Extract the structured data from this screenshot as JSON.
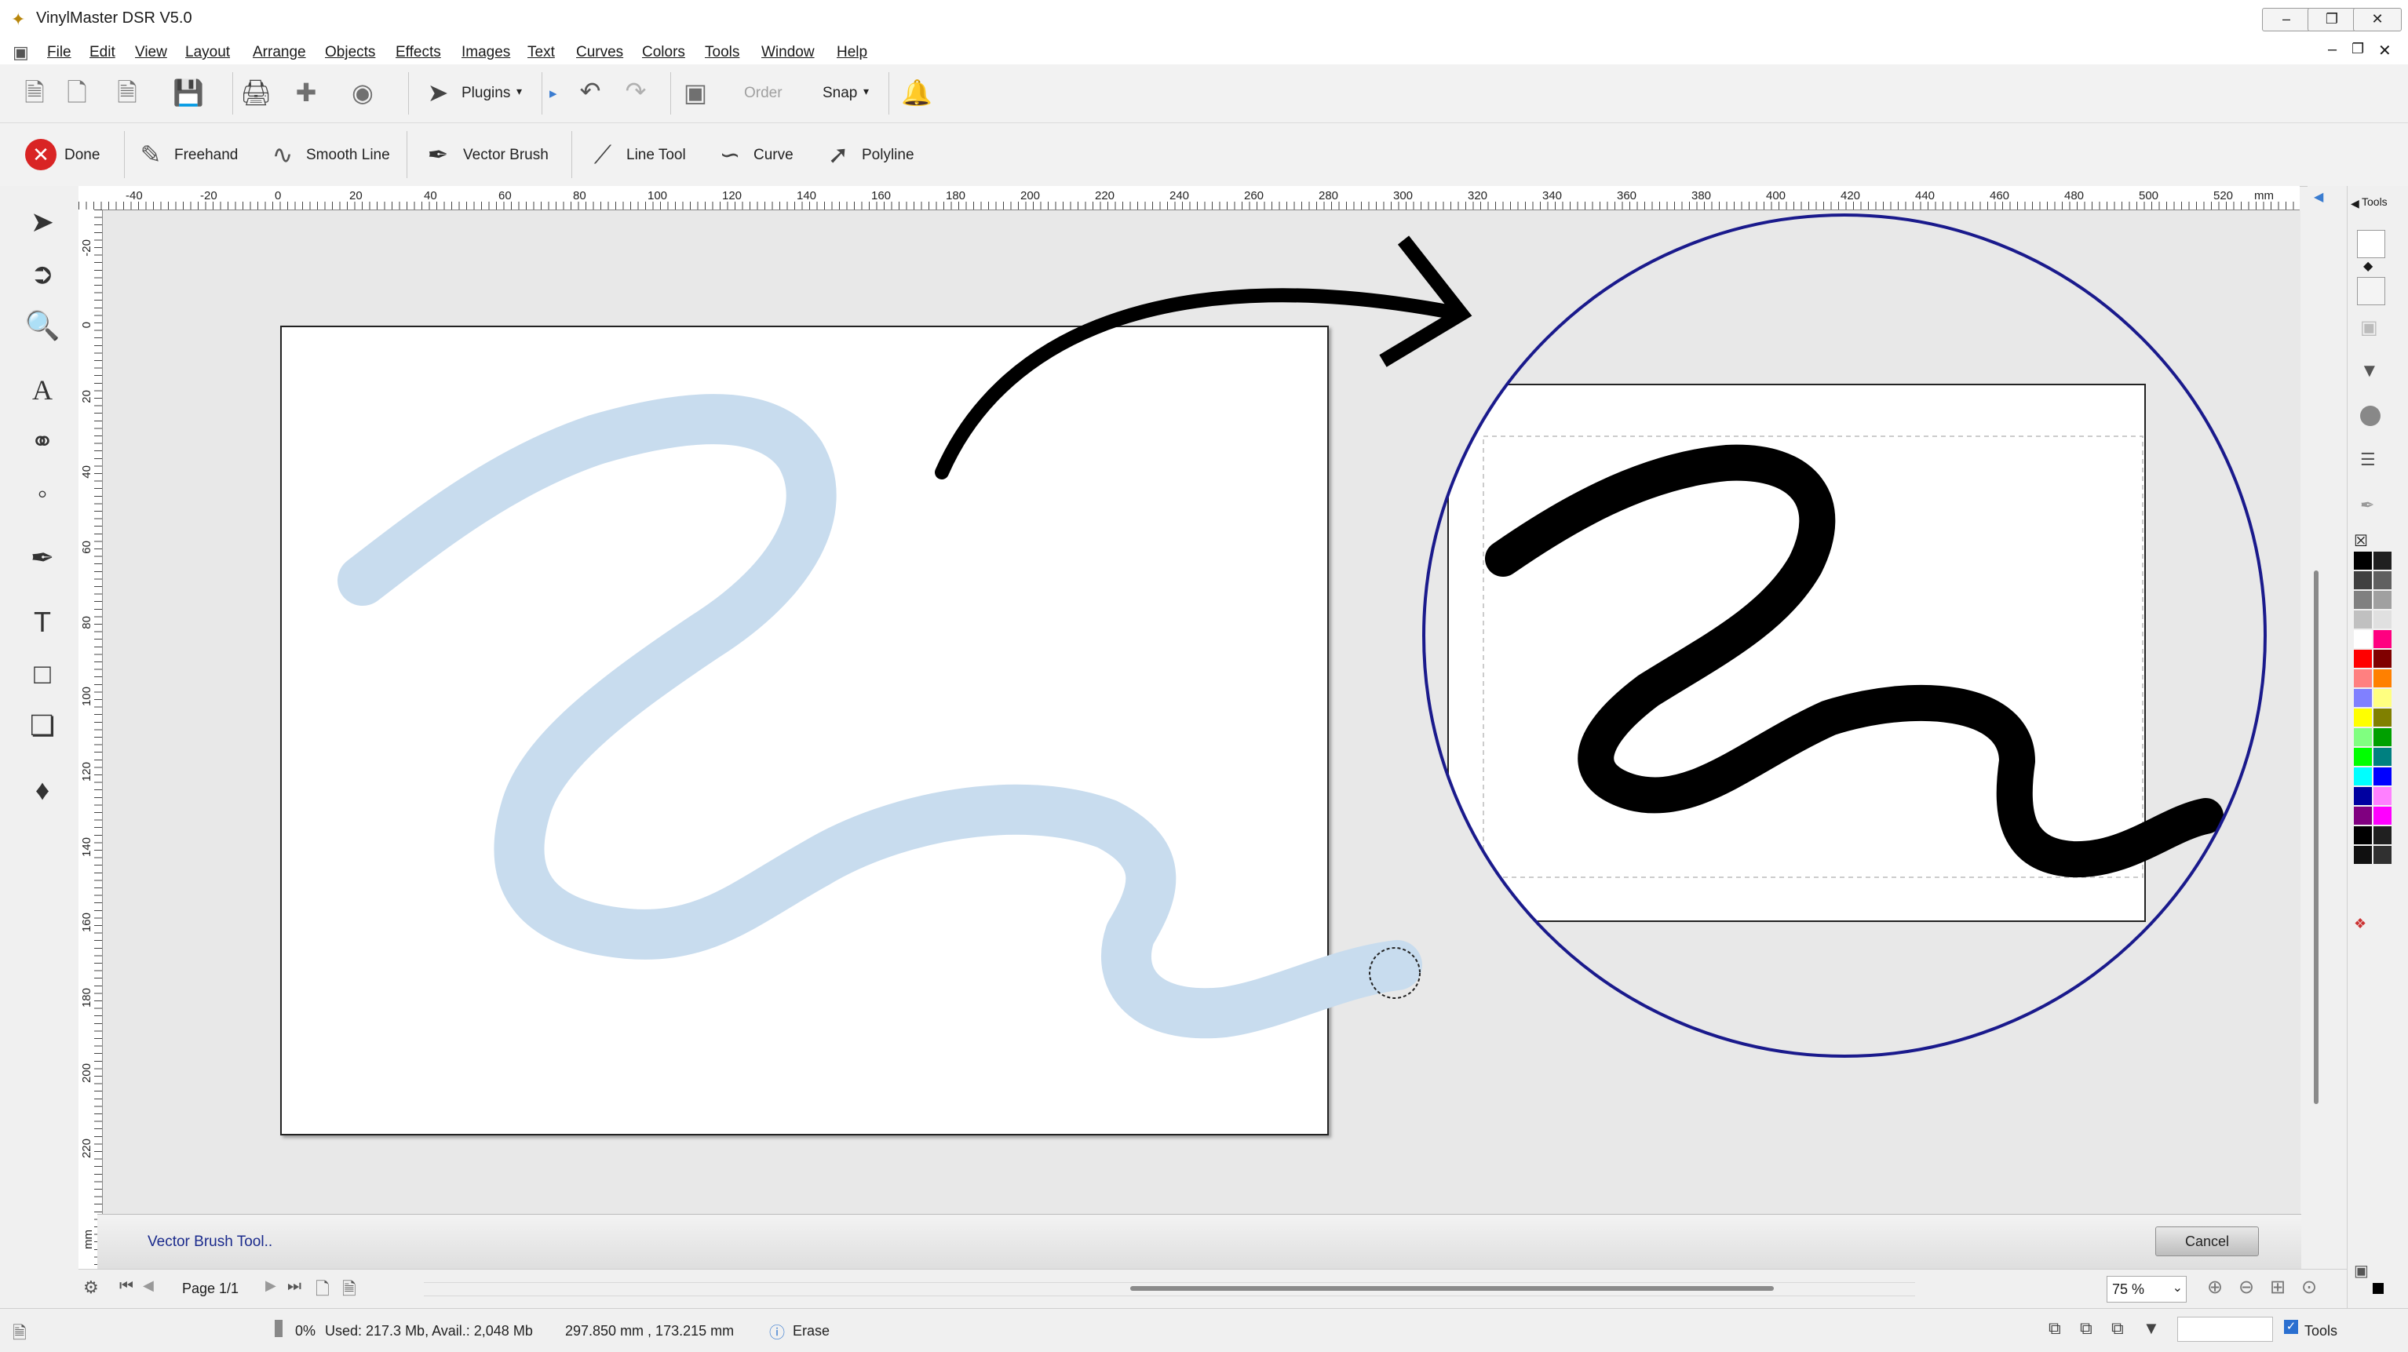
{
  "app": {
    "title": "VinylMaster DSR V5.0"
  },
  "window_controls": {
    "minimize": "–",
    "restore": "❐",
    "close": "✕"
  },
  "menu": [
    "File",
    "Edit",
    "View",
    "Layout",
    "Arrange",
    "Objects",
    "Effects",
    "Images",
    "Text",
    "Curves",
    "Colors",
    "Tools",
    "Window",
    "Help"
  ],
  "toolbar": {
    "plugins": "Plugins",
    "order": "Order",
    "snap": "Snap"
  },
  "draw_toolbar": {
    "done": "Done",
    "freehand": "Freehand",
    "smooth_line": "Smooth Line",
    "vector_brush": "Vector Brush",
    "line_tool": "Line Tool",
    "curve": "Curve",
    "polyline": "Polyline"
  },
  "ruler": {
    "unit": "mm",
    "h_labels": [
      "-40",
      "-20",
      "0",
      "20",
      "40",
      "60",
      "80",
      "100",
      "120",
      "140",
      "160",
      "180",
      "200",
      "220",
      "240",
      "260",
      "280",
      "300",
      "320",
      "340",
      "360",
      "380",
      "400",
      "420",
      "440",
      "460",
      "480",
      "500",
      "520"
    ],
    "v_labels": [
      "-20",
      "0",
      "20",
      "40",
      "60",
      "80",
      "100",
      "120",
      "140",
      "160",
      "180",
      "200",
      "220"
    ]
  },
  "prompt": {
    "text": "Vector Brush Tool..",
    "cancel": "Cancel"
  },
  "navigation": {
    "page": "Page 1/1",
    "zoom": "75 %"
  },
  "status": {
    "percent": "0%",
    "memory": "Used: 217.3 Mb, Avail.: 2,048 Mb",
    "coordinates": "297.850 mm , 173.215 mm",
    "mode": "Erase",
    "tools_label": "Tools"
  },
  "right_panel": {
    "title": "Tools"
  },
  "colors": {
    "brush_stroke": "#c8dcee",
    "zoom_circle": "#1a1a8c",
    "palette": [
      "#000000",
      "#202020",
      "#404040",
      "#606060",
      "#808080",
      "#a0a0a0",
      "#c0c0c0",
      "#e0e0e0",
      "#ffffff",
      "#ff0080",
      "#ff0000",
      "#800000",
      "#ff8080",
      "#ff8000",
      "#8080ff",
      "#ffff80",
      "#ffff00",
      "#808000",
      "#80ff80",
      "#00a000",
      "#00ff00",
      "#008080",
      "#00ffff",
      "#0000ff",
      "#0000a0",
      "#ff80ff",
      "#800080",
      "#ff00ff",
      "#000000",
      "#202020",
      "#101010",
      "#303030"
    ]
  }
}
